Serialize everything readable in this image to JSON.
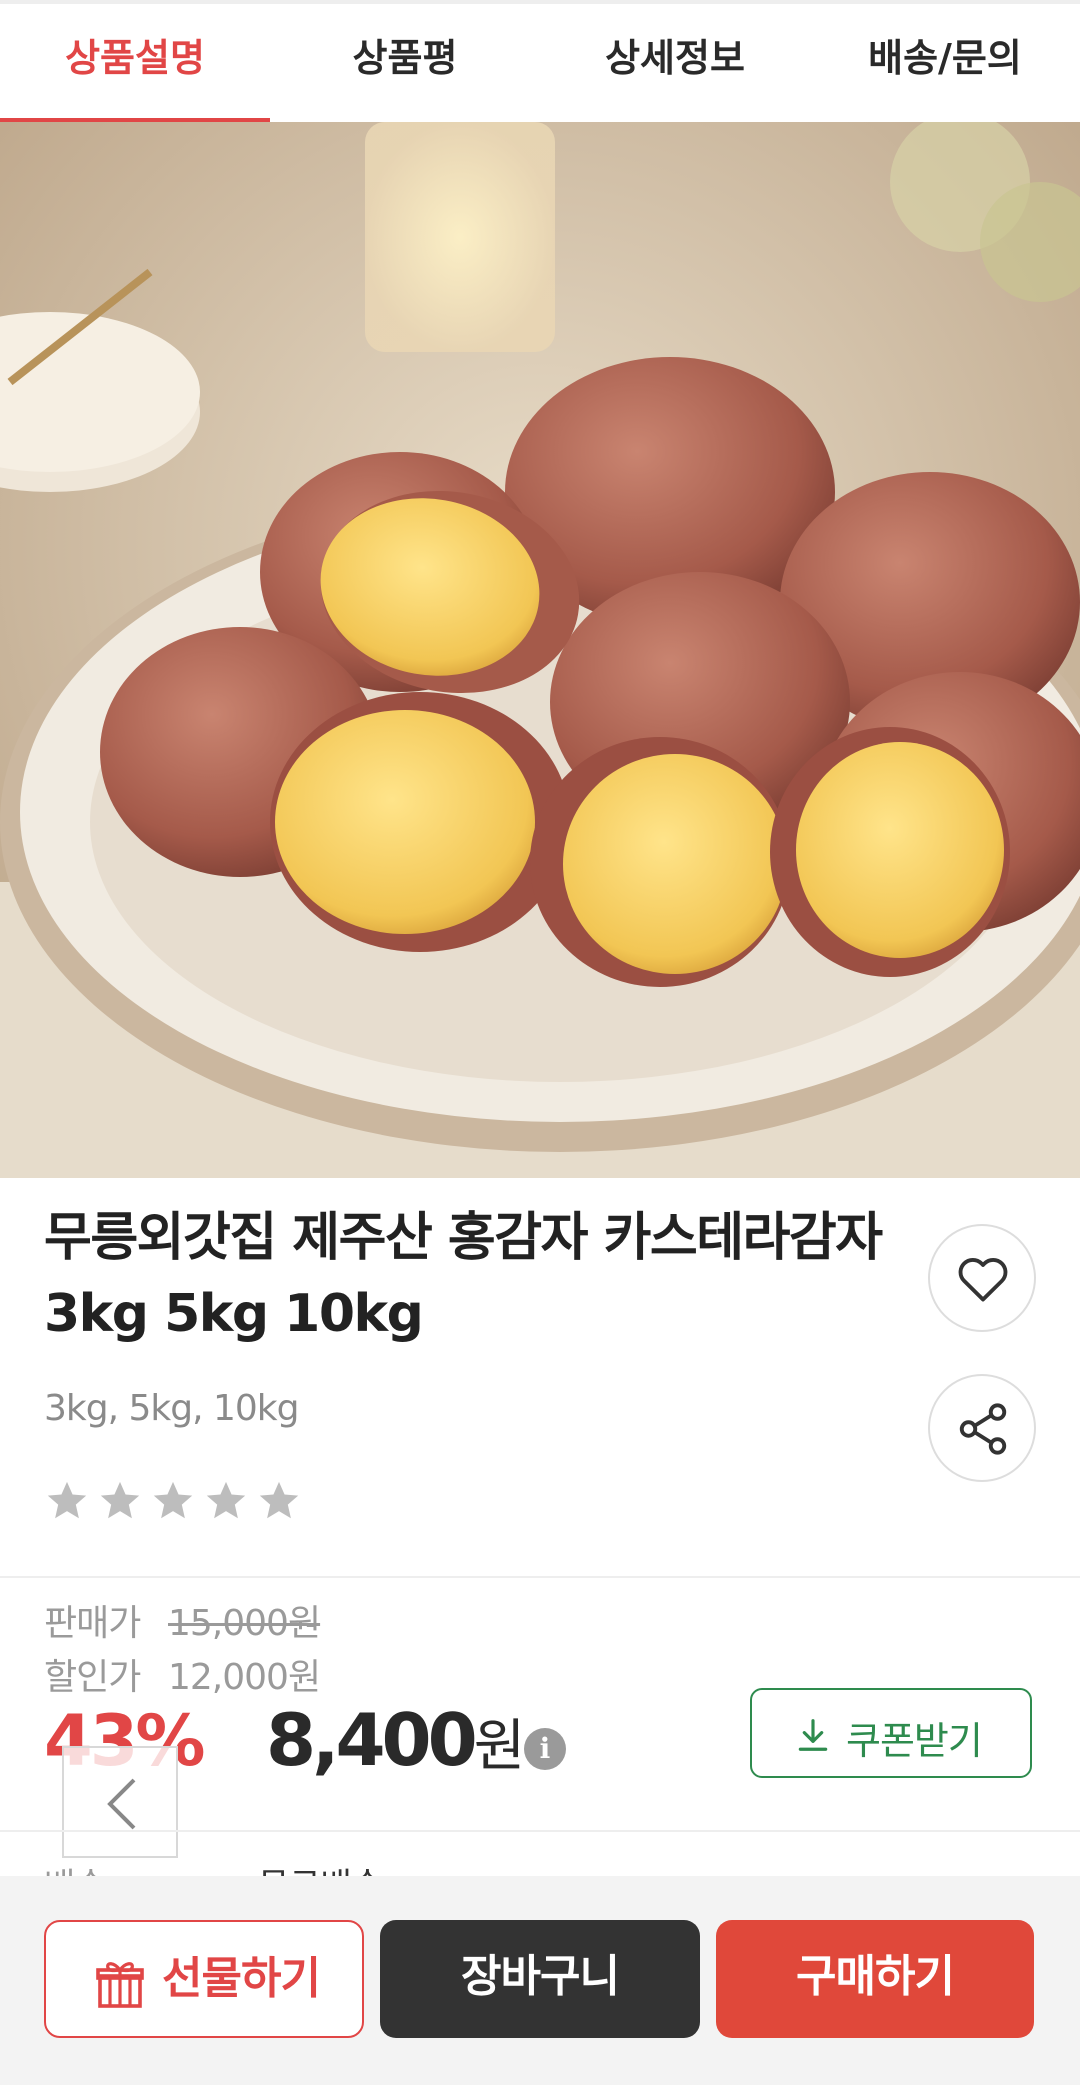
{
  "tabs": [
    {
      "label": "상품설명",
      "active": true
    },
    {
      "label": "상품평",
      "active": false
    },
    {
      "label": "상세정보",
      "active": false
    },
    {
      "label": "배송/문의",
      "active": false
    }
  ],
  "gallery": {
    "slide_count": 5,
    "current_slide": 1
  },
  "product": {
    "title_line1": "무릉외갓집 제주산 홍감자 카스테라감자",
    "title_line2": "3kg 5kg 10kg",
    "options": "3kg, 5kg, 10kg",
    "rating_stars": 5,
    "rating_filled": 0,
    "wishlist_icon": "heart-icon",
    "share_icon": "share-icon"
  },
  "pricing": {
    "sale_label": "판매가",
    "sale_price": "15,000원",
    "discount_label": "할인가",
    "discount_price": "12,000원",
    "discount_rate": "43%",
    "final_price": "8,400",
    "final_unit": "원",
    "info_symbol": "i",
    "coupon_label": "쿠폰받기",
    "coupon_icon": "download-icon"
  },
  "shipping": {
    "label": "배송",
    "value": "무료배송"
  },
  "bottom_bar": {
    "gift_label": "선물하기",
    "cart_label": "장바구니",
    "buy_label": "구매하기"
  },
  "colors": {
    "accent": "#e14646",
    "coupon_green": "#2e8b4e",
    "cart_dark": "#333333",
    "buy_red": "#e0483a"
  }
}
